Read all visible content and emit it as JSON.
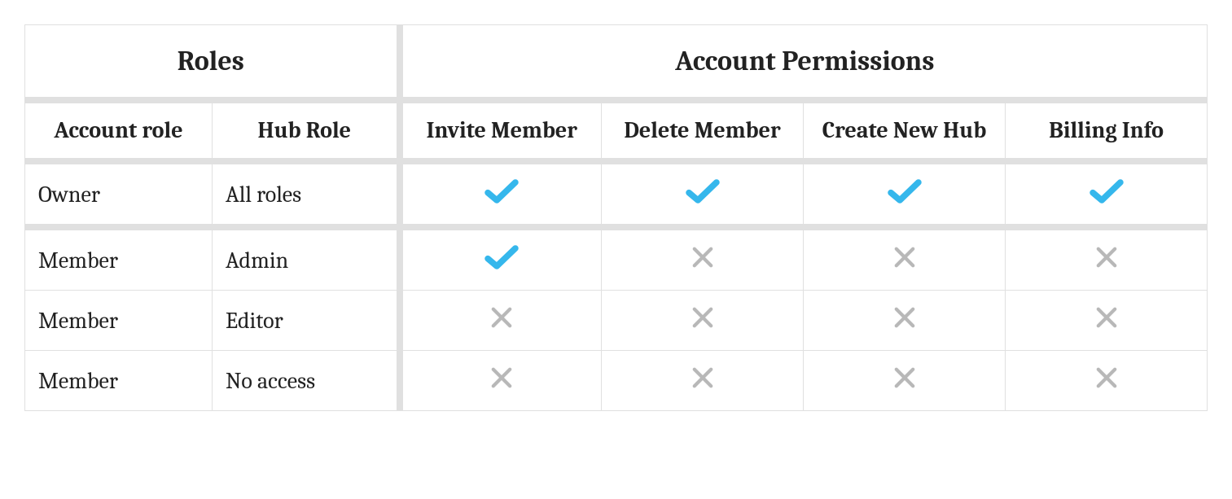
{
  "chart_data": {
    "type": "table",
    "title": "",
    "column_groups": [
      {
        "name": "Roles",
        "span": 2
      },
      {
        "name": "Account Permissions",
        "span": 4
      }
    ],
    "columns": [
      "Account role",
      "Hub Role",
      "Invite Member",
      "Delete Member",
      "Create New Hub",
      "Billing Info"
    ],
    "rows": [
      {
        "account_role": "Owner",
        "hub_role": "All roles",
        "invite_member": true,
        "delete_member": true,
        "create_new_hub": true,
        "billing_info": true
      },
      {
        "account_role": "Member",
        "hub_role": "Admin",
        "invite_member": true,
        "delete_member": false,
        "create_new_hub": false,
        "billing_info": false
      },
      {
        "account_role": "Member",
        "hub_role": "Editor",
        "invite_member": false,
        "delete_member": false,
        "create_new_hub": false,
        "billing_info": false
      },
      {
        "account_role": "Member",
        "hub_role": "No access",
        "invite_member": false,
        "delete_member": false,
        "create_new_hub": false,
        "billing_info": false
      }
    ],
    "icon_colors": {
      "true": "#35b7ec",
      "false": "#b8b8b8"
    }
  }
}
